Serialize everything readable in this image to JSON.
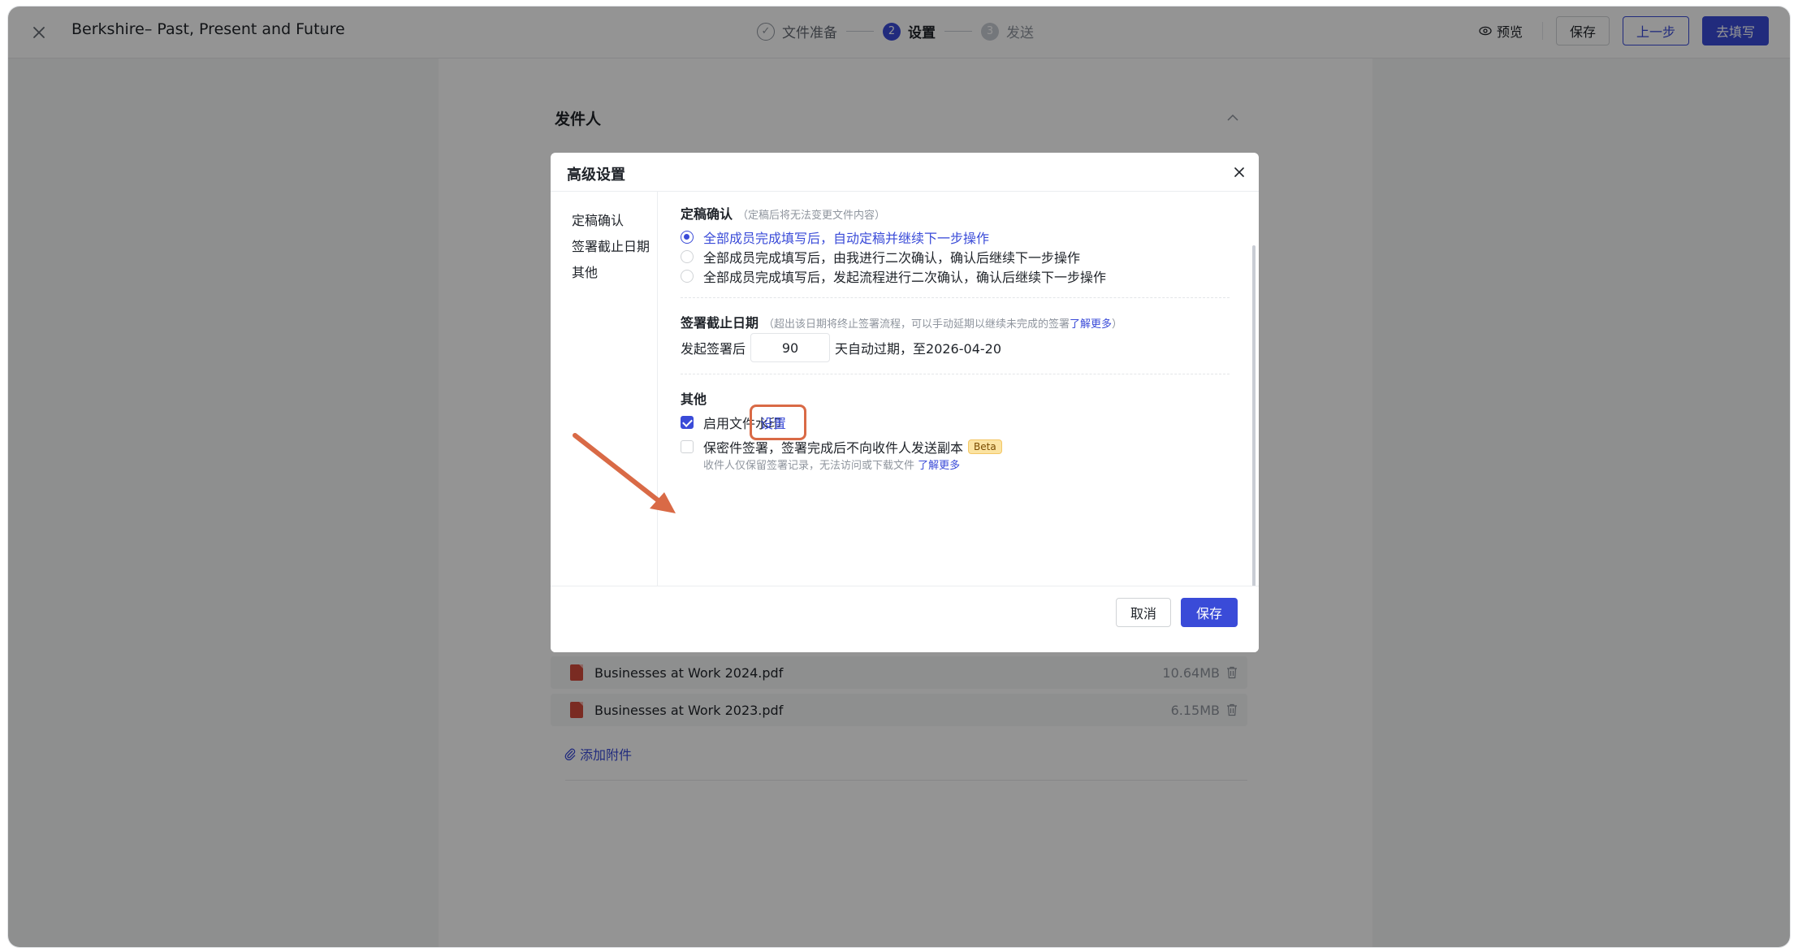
{
  "header": {
    "doc_title": "Berkshire– Past, Present and Future",
    "steps": [
      {
        "num": "1",
        "label": "文件准备",
        "state": "done"
      },
      {
        "num": "2",
        "label": "设置",
        "state": "active"
      },
      {
        "num": "3",
        "label": "发送",
        "state": "todo"
      }
    ],
    "preview_label": "预览",
    "save_label": "保存",
    "prev_label": "上一步",
    "next_label": "去填写"
  },
  "page": {
    "sender_title": "发件人",
    "attachments": [
      {
        "name": "Businesses at Work 2024.pdf",
        "size": "10.64MB"
      },
      {
        "name": "Businesses at Work 2023.pdf",
        "size": "6.15MB"
      }
    ],
    "add_attachment_label": "添加附件"
  },
  "modal": {
    "title": "高级设置",
    "nav": [
      "定稿确认",
      "签署截止日期",
      "其他"
    ],
    "finalize": {
      "title": "定稿确认",
      "hint": "（定稿后将无法变更文件内容）",
      "options": [
        "全部成员完成填写后，自动定稿并继续下一步操作",
        "全部成员完成填写后，由我进行二次确认，确认后继续下一步操作",
        "全部成员完成填写后，发起流程进行二次确认，确认后继续下一步操作"
      ],
      "selected_index": 0
    },
    "deadline": {
      "title": "签署截止日期",
      "hint": "（超出该日期将终止签署流程，可以手动延期以继续未完成的签署",
      "hint_link": "了解更多",
      "hint_end": "）",
      "prefix": "发起签署后",
      "days": "90",
      "suffix": "天自动过期，至2026-04-20"
    },
    "other": {
      "title": "其他",
      "watermark_label": "启用文件水印",
      "watermark_checked": true,
      "watermark_link": "设置",
      "secret_label": "保密件签署，签署完成后不向收件人发送副本",
      "secret_checked": false,
      "beta_label": "Beta",
      "secret_note": "收件人仅保留签署记录，无法访问或下载文件",
      "secret_note_link": "了解更多"
    },
    "cancel_label": "取消",
    "save_label": "保存"
  },
  "colors": {
    "accent": "#3a4bd8",
    "annotation": "#d96a46"
  }
}
